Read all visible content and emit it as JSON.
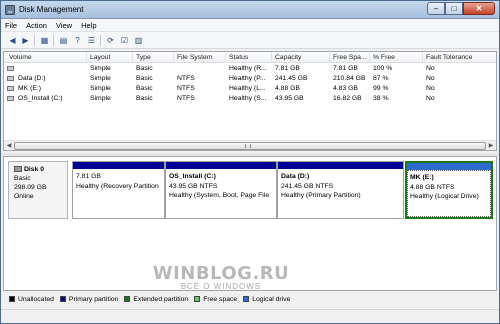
{
  "window": {
    "title": "Disk Management"
  },
  "menu": [
    "File",
    "Action",
    "View",
    "Help"
  ],
  "toolbar": {
    "icons": [
      "back-arrow-icon",
      "forward-arrow-icon",
      "properties-grid-icon",
      "console-tree-icon",
      "help-icon",
      "details-list-icon",
      "refresh-icon",
      "check-properties-icon",
      "settings-list-icon"
    ]
  },
  "volume_list": {
    "columns": [
      "Volume",
      "Layout",
      "Type",
      "File System",
      "Status",
      "Capacity",
      "Free Spa...",
      "% Free",
      "Fault Tolerance"
    ],
    "rows": [
      {
        "volume": "",
        "layout": "Simple",
        "type": "Basic",
        "fs": "",
        "status": "Healthy (R...",
        "capacity": "7.81 GB",
        "free": "7.81 GB",
        "pct": "100 %",
        "fault": "No"
      },
      {
        "volume": "Data (D:)",
        "layout": "Simple",
        "type": "Basic",
        "fs": "NTFS",
        "status": "Healthy (P...",
        "capacity": "241.45 GB",
        "free": "210.84 GB",
        "pct": "87 %",
        "fault": "No"
      },
      {
        "volume": "MK (E:)",
        "layout": "Simple",
        "type": "Basic",
        "fs": "NTFS",
        "status": "Healthy (L...",
        "capacity": "4.88 GB",
        "free": "4.83 GB",
        "pct": "99 %",
        "fault": "No"
      },
      {
        "volume": "OS_Install (C:)",
        "layout": "Simple",
        "type": "Basic",
        "fs": "NTFS",
        "status": "Healthy (S...",
        "capacity": "43.95 GB",
        "free": "16.82 GB",
        "pct": "38 %",
        "fault": "No"
      }
    ]
  },
  "disk": {
    "name": "Disk 0",
    "type": "Basic",
    "size": "298.09 GB",
    "state": "Online",
    "partitions": [
      {
        "name": "",
        "size": "7.81 GB",
        "status": "Healthy (Recovery Partition"
      },
      {
        "name": "OS_Install (C:)",
        "size": "43.95 GB NTFS",
        "status": "Healthy (System, Boot, Page File"
      },
      {
        "name": "Data (D:)",
        "size": "241.45 GB NTFS",
        "status": "Healthy (Primary Partition)"
      },
      {
        "name": "MK (E:)",
        "size": "4.88 GB NTFS",
        "status": "Healthy (Logical Drive)"
      }
    ]
  },
  "legend": [
    {
      "label": "Unallocated",
      "color": "#000000"
    },
    {
      "label": "Primary partition",
      "color": "#000094"
    },
    {
      "label": "Extended partition",
      "color": "#1a7a1a"
    },
    {
      "label": "Free space",
      "color": "#66cc66"
    },
    {
      "label": "Logical drive",
      "color": "#2d6bd0"
    }
  ],
  "watermark": {
    "main": "WINBLOG.RU",
    "sub": "ВСЁ О WINDOWS"
  }
}
